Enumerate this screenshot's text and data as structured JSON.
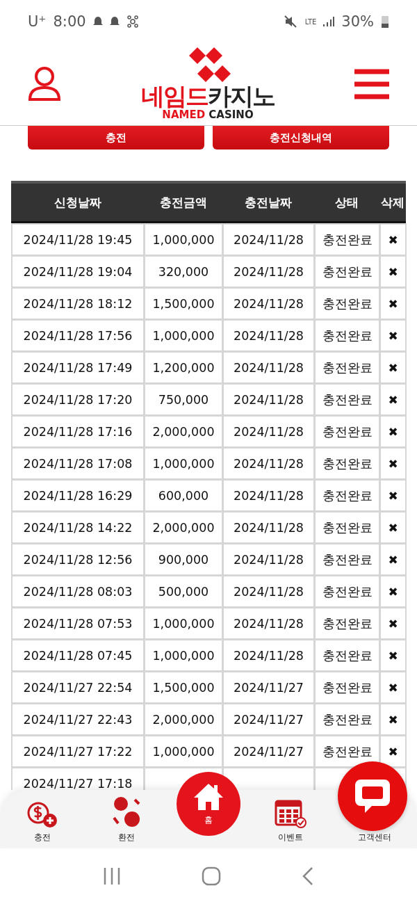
{
  "status_bar": {
    "carrier": "U⁺",
    "time": "8:00",
    "lte": "LTE",
    "battery": "30%"
  },
  "header": {
    "logo_korean_red": "네임드",
    "logo_korean_dark": "카지노",
    "logo_english_red": "NAMED",
    "logo_english_dark": "CASINO"
  },
  "actions": [
    "충전",
    "충전신청내역"
  ],
  "table": {
    "columns": [
      "신청날짜",
      "충전금액",
      "충전날짜",
      "상태",
      "삭제"
    ],
    "rows": [
      [
        "2024/11/28 19:45",
        "1,000,000",
        "2024/11/28",
        "충전완료",
        "✖"
      ],
      [
        "2024/11/28 19:04",
        "320,000",
        "2024/11/28",
        "충전완료",
        "✖"
      ],
      [
        "2024/11/28 18:12",
        "1,500,000",
        "2024/11/28",
        "충전완료",
        "✖"
      ],
      [
        "2024/11/28 17:56",
        "1,000,000",
        "2024/11/28",
        "충전완료",
        "✖"
      ],
      [
        "2024/11/28 17:49",
        "1,200,000",
        "2024/11/28",
        "충전완료",
        "✖"
      ],
      [
        "2024/11/28 17:20",
        "750,000",
        "2024/11/28",
        "충전완료",
        "✖"
      ],
      [
        "2024/11/28 17:16",
        "2,000,000",
        "2024/11/28",
        "충전완료",
        "✖"
      ],
      [
        "2024/11/28 17:08",
        "1,000,000",
        "2024/11/28",
        "충전완료",
        "✖"
      ],
      [
        "2024/11/28 16:29",
        "600,000",
        "2024/11/28",
        "충전완료",
        "✖"
      ],
      [
        "2024/11/28 14:22",
        "2,000,000",
        "2024/11/28",
        "충전완료",
        "✖"
      ],
      [
        "2024/11/28 12:56",
        "900,000",
        "2024/11/28",
        "충전완료",
        "✖"
      ],
      [
        "2024/11/28 08:03",
        "500,000",
        "2024/11/28",
        "충전완료",
        "✖"
      ],
      [
        "2024/11/28 07:53",
        "1,000,000",
        "2024/11/28",
        "충전완료",
        "✖"
      ],
      [
        "2024/11/28 07:45",
        "1,000,000",
        "2024/11/28",
        "충전완료",
        "✖"
      ],
      [
        "2024/11/27 22:54",
        "1,500,000",
        "2024/11/27",
        "충전완료",
        "✖"
      ],
      [
        "2024/11/27 22:43",
        "2,000,000",
        "2024/11/27",
        "충전완료",
        "✖"
      ],
      [
        "2024/11/27 17:22",
        "1,000,000",
        "2024/11/27",
        "충전완료",
        "✖"
      ],
      [
        "2024/11/27 17:18"
      ]
    ]
  },
  "bottom_nav": [
    {
      "kind": "charge",
      "label": "충전",
      "selected": false
    },
    {
      "kind": "exchange",
      "label": "환전",
      "selected": false
    },
    {
      "kind": "home",
      "label": "홈",
      "selected": true
    },
    {
      "kind": "event",
      "label": "이벤트",
      "selected": false
    },
    {
      "kind": "support",
      "label": "고객센터",
      "selected": false
    }
  ]
}
